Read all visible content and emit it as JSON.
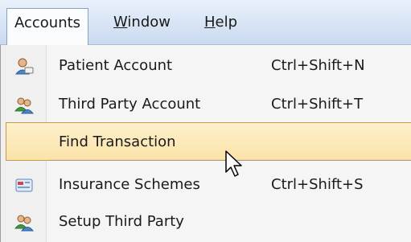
{
  "menubar": {
    "items": [
      {
        "label": "Accounts",
        "open": true
      },
      {
        "label": "Window",
        "underline": "W",
        "rest": "indow"
      },
      {
        "label": "Help",
        "underline": "H",
        "rest": "elp"
      }
    ]
  },
  "menu": {
    "items": [
      {
        "label": "Patient Account",
        "shortcut": "Ctrl+Shift+N",
        "icon": "patient-icon"
      },
      {
        "label": "Third Party Account",
        "shortcut": "Ctrl+Shift+T",
        "icon": "people-icon"
      },
      {
        "label": "Find Transaction",
        "shortcut": "",
        "icon": "",
        "highlighted": true
      },
      {
        "label": "Insurance Schemes",
        "shortcut": "Ctrl+Shift+S",
        "icon": "card-icon"
      },
      {
        "label": "Setup Third Party",
        "shortcut": "",
        "icon": "people-icon"
      }
    ]
  },
  "colors": {
    "highlight": "#fbe3a8",
    "menubar": "#c9daf0"
  }
}
